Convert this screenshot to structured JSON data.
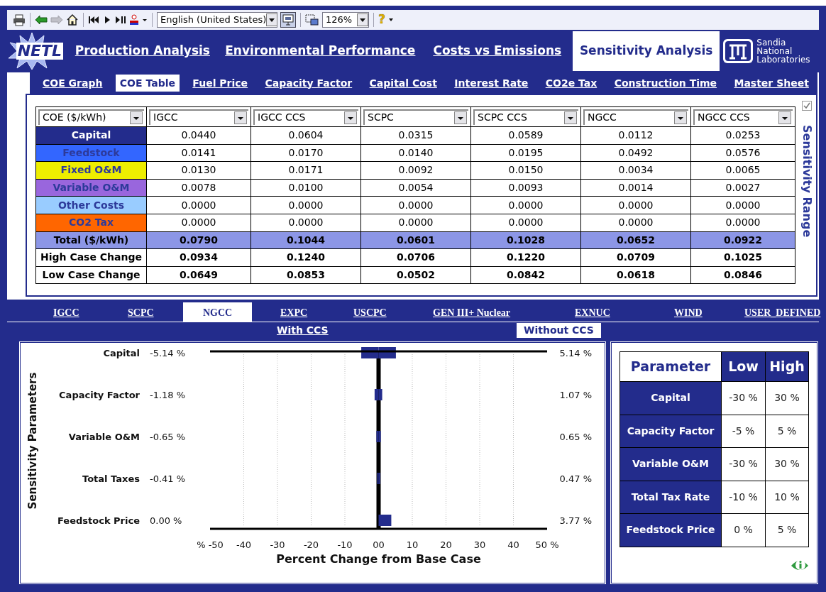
{
  "toolbar": {
    "language": "English (United States)",
    "zoom": "126%",
    "help": "?",
    "forward": {
      "disabled": true
    },
    "presentation": {
      "pressed": true
    }
  },
  "header": {
    "logo": "NETL",
    "partner_logo": [
      "Sandia",
      "National",
      "Laboratories"
    ],
    "tabs": [
      {
        "label": "Production Analysis",
        "selected": false
      },
      {
        "label": "Environmental Performance",
        "selected": false
      },
      {
        "label": "Costs vs Emissions",
        "selected": false
      },
      {
        "label": "Sensitivity Analysis",
        "selected": true
      }
    ]
  },
  "sub_tabs": [
    {
      "label": "COE Graph",
      "selected": false
    },
    {
      "label": "COE Table",
      "selected": true
    },
    {
      "label": "Fuel Price",
      "selected": false
    },
    {
      "label": "Capacity Factor",
      "selected": false
    },
    {
      "label": "Capital Cost",
      "selected": false
    },
    {
      "label": "Interest Rate",
      "selected": false
    },
    {
      "label": "CO2e Tax",
      "selected": false
    },
    {
      "label": "Construction Time",
      "selected": false
    },
    {
      "label": "Master Sheet",
      "selected": false
    }
  ],
  "coe_table": {
    "columns": [
      "COE ($/kWh)",
      "IGCC",
      "IGCC CCS",
      "SCPC",
      "SCPC CCS",
      "NGCC",
      "NGCC CCS"
    ],
    "rows": [
      {
        "kind": "cost",
        "label": "Capital",
        "color": "#232c8c",
        "values": [
          "0.0440",
          "0.0604",
          "0.0315",
          "0.0589",
          "0.0112",
          "0.0253"
        ]
      },
      {
        "kind": "cost",
        "label": "Feedstock",
        "color": "#3366ff",
        "values": [
          "0.0141",
          "0.0170",
          "0.0140",
          "0.0195",
          "0.0492",
          "0.0576"
        ]
      },
      {
        "kind": "cost",
        "label": "Fixed O&M",
        "color": "#eeee00",
        "values": [
          "0.0130",
          "0.0171",
          "0.0092",
          "0.0150",
          "0.0034",
          "0.0065"
        ]
      },
      {
        "kind": "cost",
        "label": "Variable O&M",
        "color": "#9966dd",
        "values": [
          "0.0078",
          "0.0100",
          "0.0054",
          "0.0093",
          "0.0014",
          "0.0027"
        ]
      },
      {
        "kind": "cost",
        "label": "Other Costs",
        "color": "#99ccff",
        "values": [
          "0.0000",
          "0.0000",
          "0.0000",
          "0.0000",
          "0.0000",
          "0.0000"
        ]
      },
      {
        "kind": "cost",
        "label": "CO2 Tax",
        "color": "#ff6600",
        "values": [
          "0.0000",
          "0.0000",
          "0.0000",
          "0.0000",
          "0.0000",
          "0.0000"
        ]
      },
      {
        "kind": "total",
        "label": "Total ($/kWh)",
        "values": [
          "0.0790",
          "0.1044",
          "0.0601",
          "0.1028",
          "0.0652",
          "0.0922"
        ]
      },
      {
        "kind": "case",
        "label": "High Case Change",
        "values": [
          "0.0934",
          "0.1240",
          "0.0706",
          "0.1220",
          "0.0709",
          "0.1025"
        ]
      },
      {
        "kind": "case",
        "label": "Low Case Change",
        "values": [
          "0.0649",
          "0.0853",
          "0.0502",
          "0.0842",
          "0.0618",
          "0.0846"
        ]
      }
    ],
    "range_checkbox": {
      "checked": true
    },
    "range_label": "Sensitivity Range"
  },
  "technology_tabs": [
    {
      "label": "IGCC",
      "selected": false
    },
    {
      "label": "SCPC",
      "selected": false
    },
    {
      "label": "NGCC",
      "selected": true
    },
    {
      "label": "EXPC",
      "selected": false
    },
    {
      "label": "USCPC",
      "selected": false
    },
    {
      "label": "GEN III+ Nuclear",
      "selected": false
    },
    {
      "label": "EXNUC",
      "selected": false
    },
    {
      "label": "WIND",
      "selected": false
    },
    {
      "label": "USER_DEFINED",
      "selected": false
    }
  ],
  "ccs_tabs": [
    {
      "label": "With CCS",
      "selected": false
    },
    {
      "label": "Without CCS",
      "selected": true
    }
  ],
  "tornado": {
    "chart_data": {
      "type": "bar",
      "orientation": "horizontal",
      "stacked": true,
      "grid": true,
      "xlabel": "Percent Change from Base Case",
      "ylabel": "Sensitivity Parameters",
      "categories": [
        "Capital",
        "Capacity Factor",
        "Variable O&M",
        "Total Taxes",
        "Feedstock Price"
      ],
      "series": [
        {
          "color": "#232c8c",
          "values": [
            -5.14,
            -1.18,
            -0.65,
            -0.41,
            0.0
          ]
        },
        {
          "color": "#232c8c",
          "values": [
            5.14,
            1.07,
            0.65,
            0.47,
            3.77
          ]
        }
      ],
      "value_labels": [
        [
          "-5.14 %",
          "-1.18 %",
          "-0.65 %",
          "-0.41 %",
          "0.00 %"
        ],
        [
          "5.14 %",
          "1.07 %",
          "0.65 %",
          "0.47 %",
          "3.77 %"
        ]
      ],
      "xlim": [
        -50,
        50
      ],
      "xticks": [
        {
          "value": -50,
          "label": "% -50"
        },
        -40,
        -30,
        -20,
        -10,
        {
          "value": 0,
          "label": "00"
        },
        10,
        20,
        30,
        40,
        {
          "value": 50,
          "label": "50 %"
        }
      ]
    }
  },
  "parameter_table": {
    "columns": [
      "Parameter",
      "Low",
      "High"
    ],
    "rows": [
      {
        "label": "Capital",
        "low": "-30 %",
        "high": "30 %"
      },
      {
        "label": "Capacity Factor",
        "low": "-5 %",
        "high": "5 %"
      },
      {
        "label": "Variable O&M",
        "low": "-30 %",
        "high": "30 %"
      },
      {
        "label": "Total Tax Rate",
        "low": "-10 %",
        "high": "10 %"
      },
      {
        "label": "Feedstock Price",
        "low": "0 %",
        "high": "5 %"
      }
    ]
  }
}
